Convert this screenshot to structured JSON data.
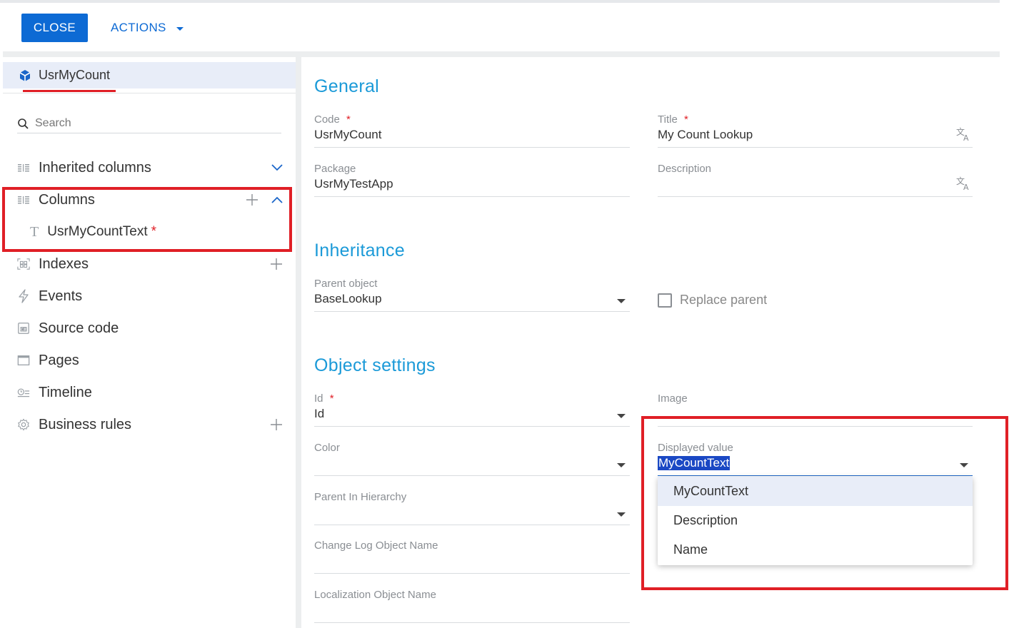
{
  "toolbar": {
    "close_label": "CLOSE",
    "actions_label": "ACTIONS"
  },
  "sidebar": {
    "object_name": "UsrMyCount",
    "search_placeholder": "Search",
    "items": [
      {
        "label": "Inherited columns",
        "icon": "columns-icon"
      },
      {
        "label": "Columns",
        "icon": "columns-icon"
      },
      {
        "label": "Indexes",
        "icon": "indexes-icon"
      },
      {
        "label": "Events",
        "icon": "lightning-icon"
      },
      {
        "label": "Source code",
        "icon": "source-code-icon"
      },
      {
        "label": "Pages",
        "icon": "window-icon"
      },
      {
        "label": "Timeline",
        "icon": "timeline-icon"
      },
      {
        "label": "Business rules",
        "icon": "gear-icon"
      }
    ],
    "column_child": {
      "label": "UsrMyCountText",
      "required_mark": "*"
    }
  },
  "main": {
    "sections": {
      "general": "General",
      "inheritance": "Inheritance",
      "object_settings": "Object settings"
    },
    "fields": {
      "code": {
        "label": "Code",
        "required": "*",
        "value": "UsrMyCount"
      },
      "title": {
        "label": "Title",
        "required": "*",
        "value": "My Count Lookup"
      },
      "package": {
        "label": "Package",
        "value": "UsrMyTestApp"
      },
      "description": {
        "label": "Description",
        "value": ""
      },
      "parent_object": {
        "label": "Parent object",
        "value": "BaseLookup"
      },
      "replace_parent": {
        "label": "Replace parent",
        "checked": false
      },
      "id": {
        "label": "Id",
        "required": "*",
        "value": "Id"
      },
      "image": {
        "label": "Image",
        "value": ""
      },
      "color": {
        "label": "Color",
        "value": ""
      },
      "displayed_value": {
        "label": "Displayed value",
        "value": "MyCountText"
      },
      "parent_in_hierarchy": {
        "label": "Parent In Hierarchy",
        "value": ""
      },
      "change_log_object_name": {
        "label": "Change Log Object Name",
        "value": ""
      },
      "localization_object_name": {
        "label": "Localization Object Name",
        "value": ""
      }
    },
    "displayed_value_options": [
      "MyCountText",
      "Description",
      "Name"
    ]
  },
  "colors": {
    "accent": "#0d6ad4",
    "section_title": "#1b9ad8",
    "highlight_box": "#e01f26"
  }
}
